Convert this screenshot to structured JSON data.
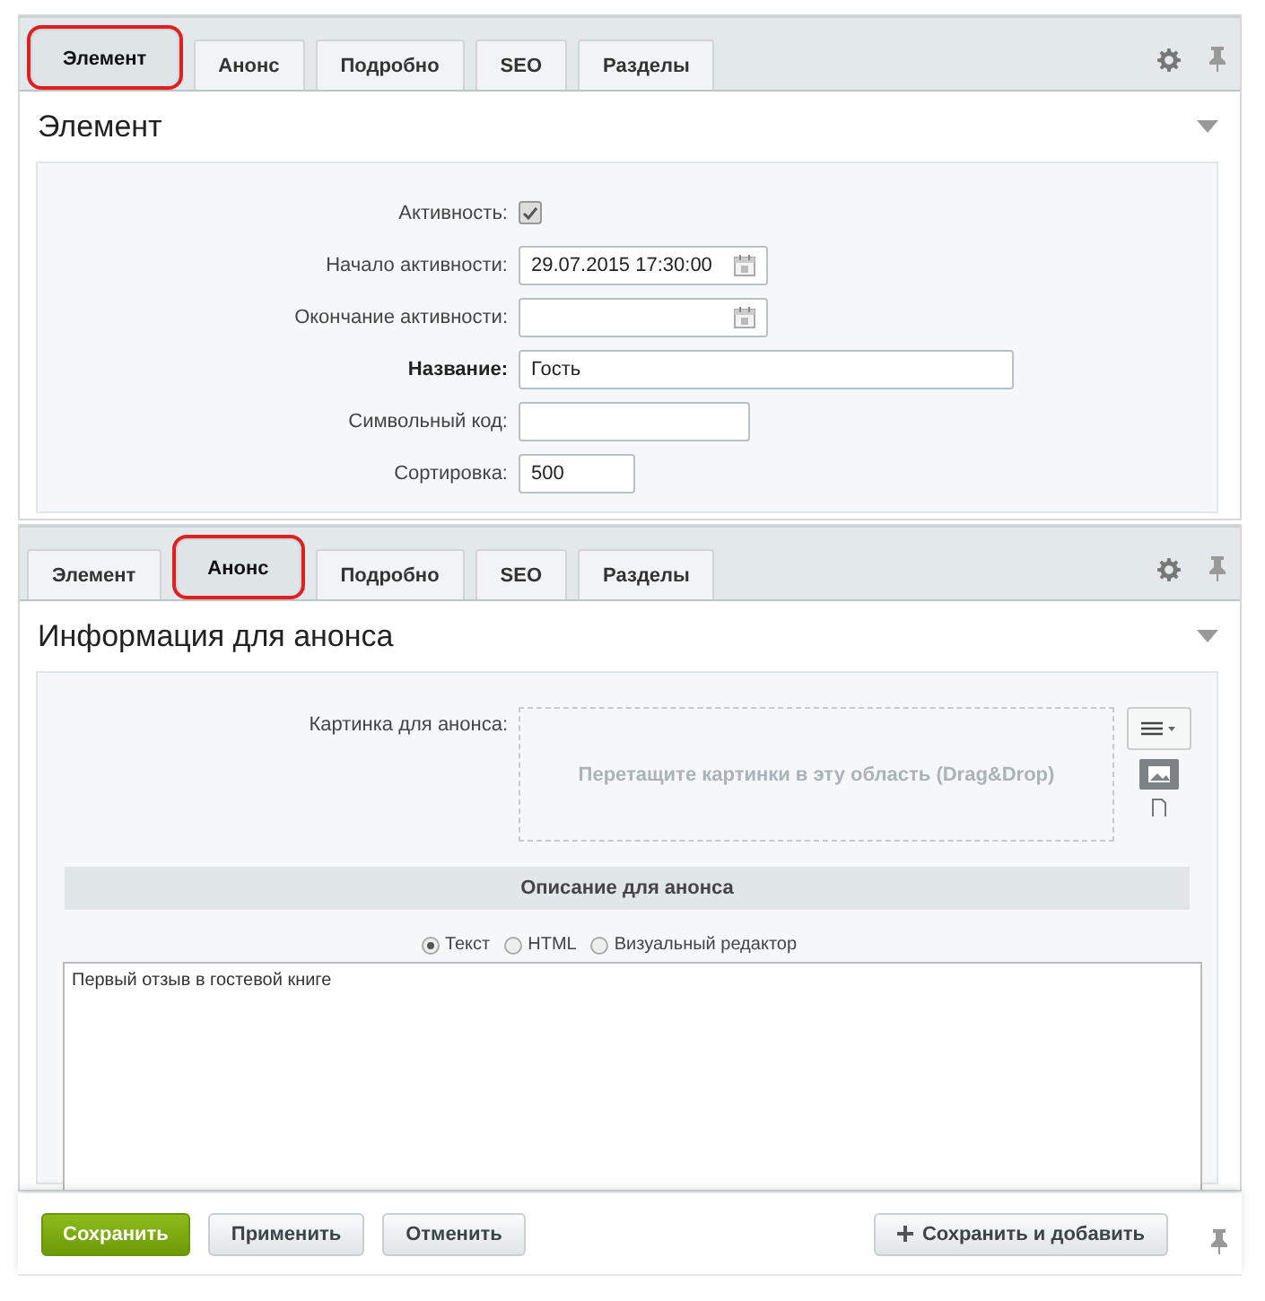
{
  "panels": [
    {
      "tabs": [
        {
          "label": "Элемент",
          "selected": true
        },
        {
          "label": "Анонс",
          "selected": false
        },
        {
          "label": "Подробно",
          "selected": false
        },
        {
          "label": "SEO",
          "selected": false
        },
        {
          "label": "Разделы",
          "selected": false
        }
      ],
      "title": "Элемент",
      "fields": [
        {
          "kind": "checkbox",
          "label": "Активность:",
          "checked": true
        },
        {
          "kind": "date",
          "label": "Начало активности:",
          "value": "29.07.2015 17:30:00"
        },
        {
          "kind": "date",
          "label": "Окончание активности:"
        },
        {
          "kind": "text-long",
          "label": "Название:",
          "required": true,
          "value": "Гость"
        },
        {
          "kind": "text",
          "label": "Символьный код:",
          "required": false
        },
        {
          "kind": "text-short",
          "label": "Сортировка:",
          "required": false,
          "value": "500"
        }
      ]
    },
    {
      "tabs": [
        {
          "label": "Элемент",
          "selected": false
        },
        {
          "label": "Анонс",
          "selected": true
        },
        {
          "label": "Подробно",
          "selected": false
        },
        {
          "label": "SEO",
          "selected": false
        },
        {
          "label": "Разделы",
          "selected": false
        }
      ],
      "title": "Информация для анонса",
      "fields": [
        {
          "kind": "image",
          "label": "Картинка для анонса:",
          "hint": "Перетащите картинки в эту область (Drag&Drop)"
        },
        {
          "kind": "section",
          "label": "Описание для анонса"
        },
        {
          "kind": "radios",
          "options": [
            {
              "label": "Текст",
              "selected": true
            },
            {
              "label": "HTML",
              "selected": false
            },
            {
              "label": "Визуальный редактор",
              "selected": false
            }
          ]
        },
        {
          "kind": "textarea",
          "value": "Первый отзыв в гостевой книге"
        }
      ]
    }
  ],
  "footer": {
    "buttons": [
      {
        "label": "Сохранить",
        "kind": "primary"
      },
      {
        "label": "Применить",
        "kind": "default"
      },
      {
        "label": "Отменить",
        "kind": "default"
      },
      {
        "label": "Сохранить и добавить",
        "kind": "add"
      }
    ]
  }
}
